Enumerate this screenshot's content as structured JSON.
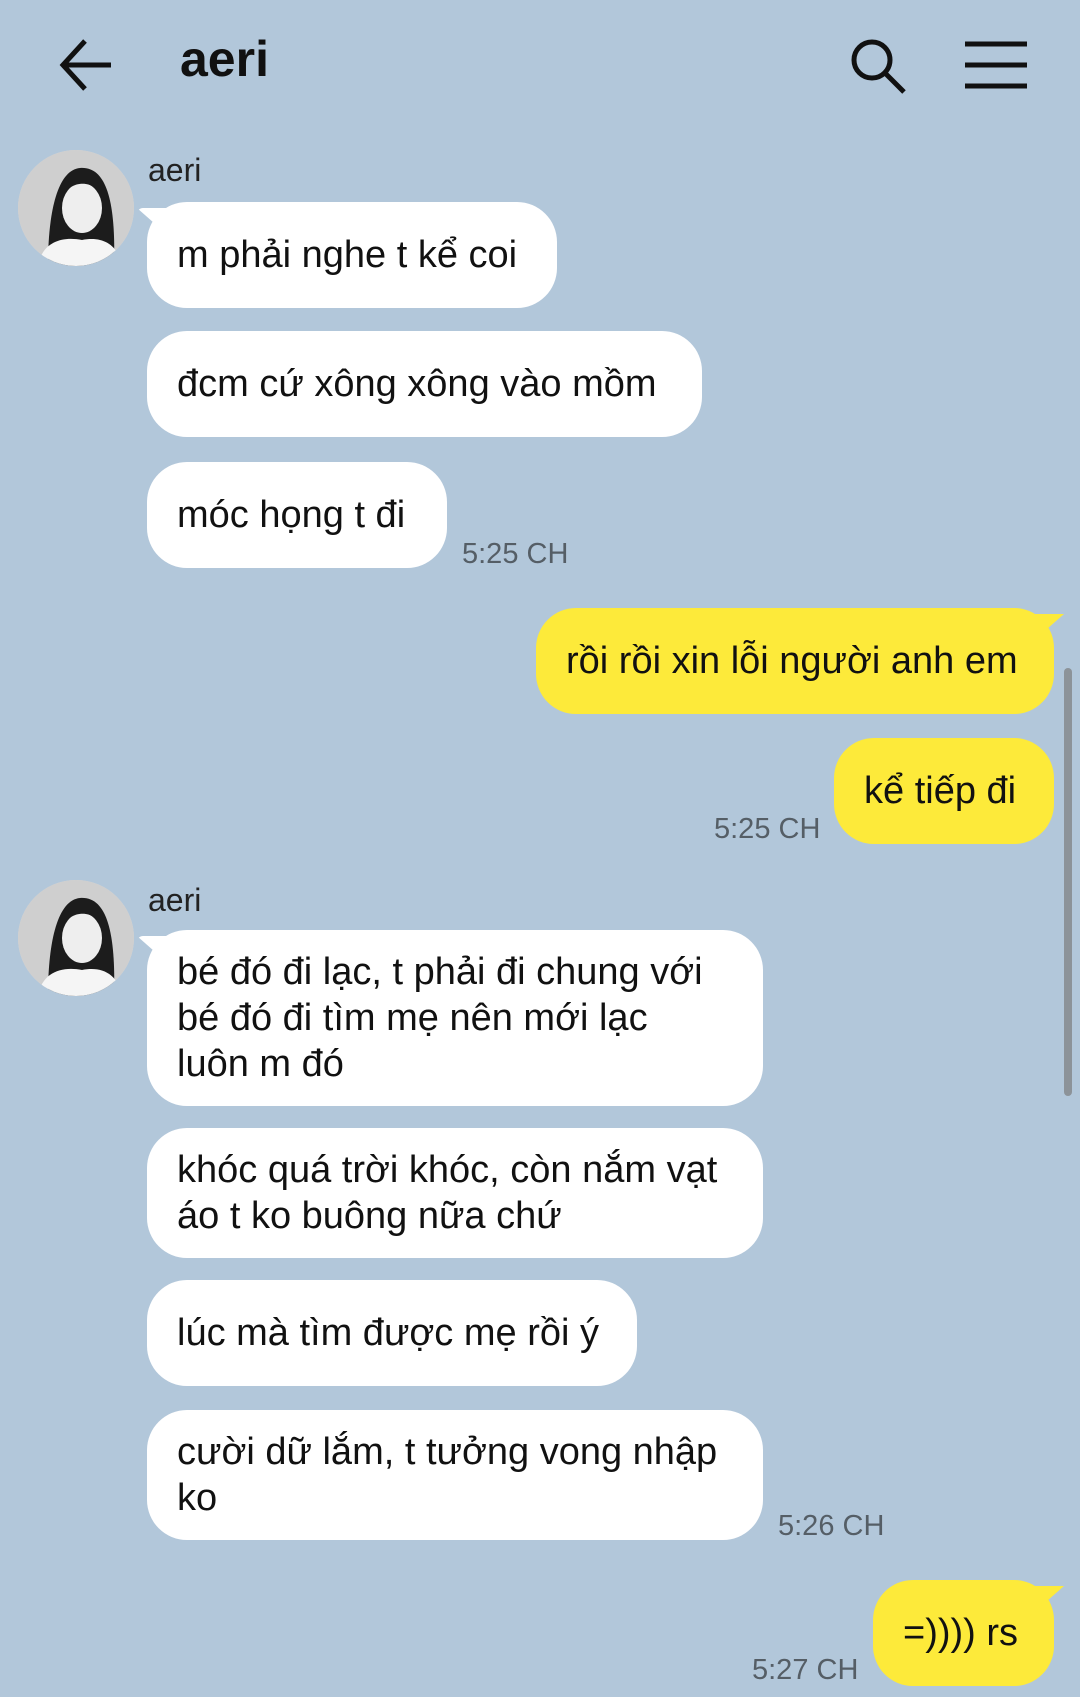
{
  "header": {
    "title": "aeri",
    "back_icon": "arrow-left-icon",
    "search_icon": "search-icon",
    "menu_icon": "hamburger-menu-icon"
  },
  "colors": {
    "background": "#b2c7da",
    "incoming_bubble": "#ffffff",
    "outgoing_bubble": "#fdea3a"
  },
  "groups": [
    {
      "direction": "incoming",
      "sender": "aeri",
      "messages": [
        "m phải nghe t kể coi",
        "đcm cứ xông xông vào mồm",
        "móc họng t đi"
      ],
      "time": "5:25 CH"
    },
    {
      "direction": "outgoing",
      "messages": [
        "rồi rồi xin lỗi người anh em",
        "kể tiếp đi"
      ],
      "time": "5:25 CH"
    },
    {
      "direction": "incoming",
      "sender": "aeri",
      "messages": [
        "bé đó đi lạc, t phải đi chung với\nbé đó đi tìm mẹ nên mới lạc\nluôn m đó",
        "khóc quá trời khóc, còn nắm vạt\náo t ko buông nữa chứ",
        "lúc mà tìm được mẹ rồi ý",
        "cười dữ lắm, t tưởng vong nhập\nko"
      ],
      "time": "5:26 CH"
    },
    {
      "direction": "outgoing",
      "messages": [
        "=)))) rs"
      ],
      "time": "5:27 CH"
    }
  ]
}
